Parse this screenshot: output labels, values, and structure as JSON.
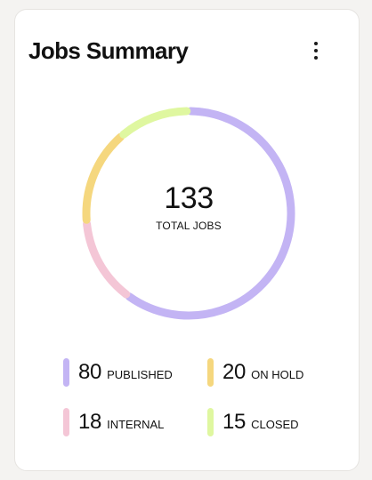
{
  "card": {
    "title": "Jobs Summary",
    "menu_icon": "more-vertical-icon"
  },
  "summary": {
    "total": "133",
    "total_label": "TOTAL JOBS"
  },
  "chart_data": {
    "type": "pie",
    "donut": true,
    "categories": [
      "PUBLISHED",
      "INTERNAL",
      "ON HOLD",
      "CLOSED"
    ],
    "values": [
      80,
      18,
      20,
      15
    ],
    "colors": [
      "#c3b4f4",
      "#f4c6d6",
      "#f5d77e",
      "#dff7a0"
    ],
    "center_value": 133,
    "center_label": "TOTAL JOBS"
  },
  "legend": [
    {
      "value": "80",
      "label": "PUBLISHED",
      "color": "#c3b4f4"
    },
    {
      "value": "20",
      "label": "ON HOLD",
      "color": "#f5d77e"
    },
    {
      "value": "18",
      "label": "INTERNAL",
      "color": "#f4c6d6"
    },
    {
      "value": "15",
      "label": "CLOSED",
      "color": "#dff7a0"
    }
  ]
}
